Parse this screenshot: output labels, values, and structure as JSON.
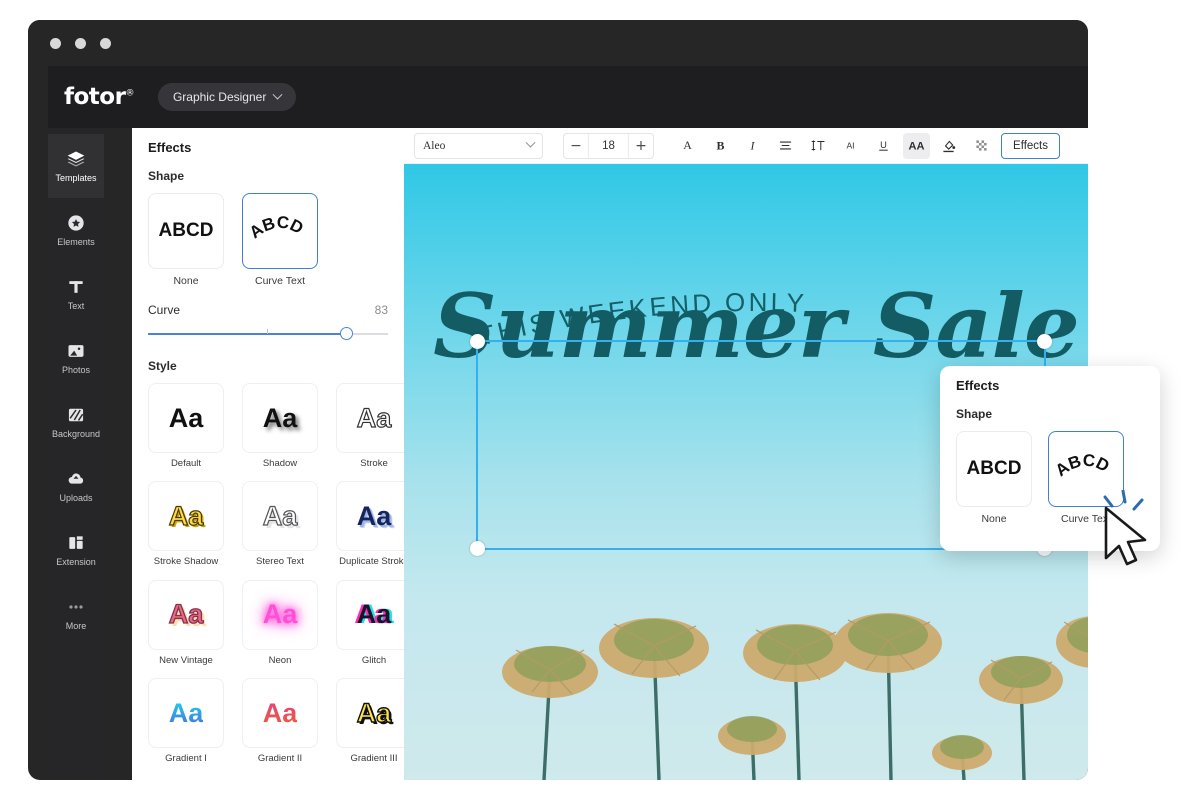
{
  "window": {
    "traffic_lights": [
      "close",
      "minimize",
      "maximize"
    ]
  },
  "header": {
    "brand": "fotor",
    "brand_mark": "®",
    "workspace": "Graphic Designer",
    "workspace_chevron": "chevron-down-icon"
  },
  "sidebar": {
    "items": [
      {
        "label": "Templates",
        "icon": "layers-icon",
        "active": true
      },
      {
        "label": "Elements",
        "icon": "star-badge-icon",
        "active": false
      },
      {
        "label": "Text",
        "icon": "text-t-icon",
        "active": false
      },
      {
        "label": "Photos",
        "icon": "photo-icon",
        "active": false
      },
      {
        "label": "Background",
        "icon": "pattern-icon",
        "active": false
      },
      {
        "label": "Uploads",
        "icon": "upload-cloud-icon",
        "active": false
      },
      {
        "label": "Extension",
        "icon": "puzzle-icon",
        "active": false
      },
      {
        "label": "More",
        "icon": "ellipsis-icon",
        "active": false
      }
    ]
  },
  "effects_panel": {
    "title": "Effects",
    "shape_section_label": "Shape",
    "shapes": [
      {
        "label": "None",
        "sample": "ABCD",
        "selected": false
      },
      {
        "label": "Curve Text",
        "sample": "ABCD",
        "selected": true
      }
    ],
    "curve": {
      "label": "Curve",
      "value": "83",
      "min": 0,
      "max": 100
    },
    "style_section_label": "Style",
    "styles": [
      {
        "label": "Default",
        "sample": "Aa",
        "class": "aa-default"
      },
      {
        "label": "Shadow",
        "sample": "Aa",
        "class": "aa-shadow"
      },
      {
        "label": "Stroke",
        "sample": "Aa",
        "class": "aa-stroke"
      },
      {
        "label": "Stroke Shadow",
        "sample": "Aa",
        "class": "aa-strokeshadow"
      },
      {
        "label": "Stereo Text",
        "sample": "Aa",
        "class": "aa-stereo"
      },
      {
        "label": "Duplicate Stroke",
        "sample": "Aa",
        "class": "aa-duplicate"
      },
      {
        "label": "New Vintage",
        "sample": "Aa",
        "class": "aa-vintage"
      },
      {
        "label": "Neon",
        "sample": "Aa",
        "class": "aa-neon"
      },
      {
        "label": "Glitch",
        "sample": "Aa",
        "class": "aa-glitch"
      },
      {
        "label": "Gradient I",
        "sample": "Aa",
        "class": "aa-grad1"
      },
      {
        "label": "Gradient II",
        "sample": "Aa",
        "class": "aa-grad2"
      },
      {
        "label": "Gradient III",
        "sample": "Aa",
        "class": "aa-grad3"
      }
    ]
  },
  "toolbar": {
    "font_family": "Aleo",
    "font_size": "18",
    "decrease_label": "−",
    "increase_label": "+",
    "buttons": [
      {
        "name": "font-color-button",
        "glyph": "A",
        "active": false
      },
      {
        "name": "bold-button",
        "glyph": "B",
        "active": false
      },
      {
        "name": "italic-button",
        "glyph": "I",
        "active": false
      },
      {
        "name": "align-button",
        "glyph": "☰",
        "active": false
      },
      {
        "name": "line-height-button",
        "glyph": "IT",
        "active": false
      },
      {
        "name": "letter-spacing-button",
        "glyph": "AI",
        "active": false
      },
      {
        "name": "underline-button",
        "glyph": "U",
        "active": false
      },
      {
        "name": "text-effects-button",
        "glyph": "AA",
        "active": true
      },
      {
        "name": "highlight-button",
        "glyph": "✒",
        "active": false
      },
      {
        "name": "transparency-button",
        "glyph": "░",
        "active": false
      }
    ],
    "effects_label": "Effects"
  },
  "canvas": {
    "curved_text": "THIS WEEKEND ONLY",
    "headline": "Summer Sale",
    "background_top_color": "#2fc8e6",
    "background_bottom_color": "#cfe9ec",
    "text_color": "#145c64",
    "selection_color": "#35b0ef"
  },
  "popup": {
    "title": "Effects",
    "shape_section_label": "Shape",
    "shapes": [
      {
        "label": "None",
        "sample": "ABCD",
        "selected": false
      },
      {
        "label": "Curve Text",
        "sample": "ABCD",
        "selected": true
      }
    ],
    "cursor": "mouse-pointer-icon"
  }
}
